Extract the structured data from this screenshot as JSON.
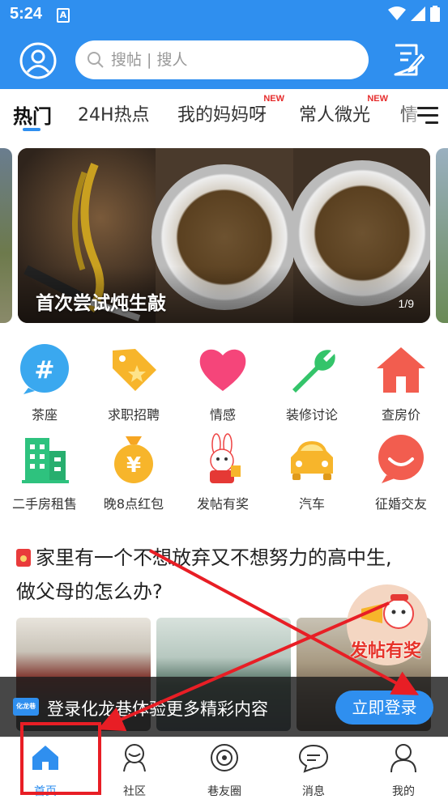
{
  "status_bar": {
    "time": "5:24",
    "notification_icon": "A"
  },
  "header": {
    "search_placeholder": "搜帖 | 搜人"
  },
  "tabs": [
    {
      "label": "热门",
      "active": true,
      "new": ""
    },
    {
      "label": "24H热点",
      "active": false,
      "new": ""
    },
    {
      "label": "我的妈妈呀",
      "active": false,
      "new": "NEW"
    },
    {
      "label": "常人微光",
      "active": false,
      "new": "NEW"
    },
    {
      "label": "情",
      "active": false,
      "new": ""
    }
  ],
  "banner": {
    "caption": "首次尝试炖生敲",
    "counter": "1/9"
  },
  "categories": [
    {
      "label": "茶座",
      "icon": "hash-bubble-icon"
    },
    {
      "label": "求职招聘",
      "icon": "star-tag-icon"
    },
    {
      "label": "情感",
      "icon": "heart-icon"
    },
    {
      "label": "装修讨论",
      "icon": "wrench-icon"
    },
    {
      "label": "查房价",
      "icon": "house-icon"
    },
    {
      "label": "二手房租售",
      "icon": "building-icon"
    },
    {
      "label": "晚8点红包",
      "icon": "money-bag-icon"
    },
    {
      "label": "发帖有奖",
      "icon": "rabbit-mascot-icon"
    },
    {
      "label": "汽车",
      "icon": "car-icon"
    },
    {
      "label": "征婚交友",
      "icon": "smile-bubble-icon"
    }
  ],
  "post": {
    "title_line1": "家里有一个不想放弃又不想努力的高中生,",
    "title_line2": "做父母的怎么办?"
  },
  "float_badge": {
    "text": "发帖有奖"
  },
  "login_bar": {
    "logo_text": "化龙巷",
    "text": "登录化龙巷体验更多精彩内容",
    "button": "立即登录"
  },
  "bottom_nav": [
    {
      "label": "首页",
      "icon": "home-icon",
      "active": true
    },
    {
      "label": "社区",
      "icon": "community-icon",
      "active": false
    },
    {
      "label": "巷友圈",
      "icon": "circle-icon",
      "active": false
    },
    {
      "label": "消息",
      "icon": "message-icon",
      "active": false
    },
    {
      "label": "我的",
      "icon": "profile-icon",
      "active": false
    }
  ],
  "colors": {
    "brand_blue": "#2f8fef",
    "annotation_red": "#e81e25",
    "new_badge": "#e62d2d"
  }
}
